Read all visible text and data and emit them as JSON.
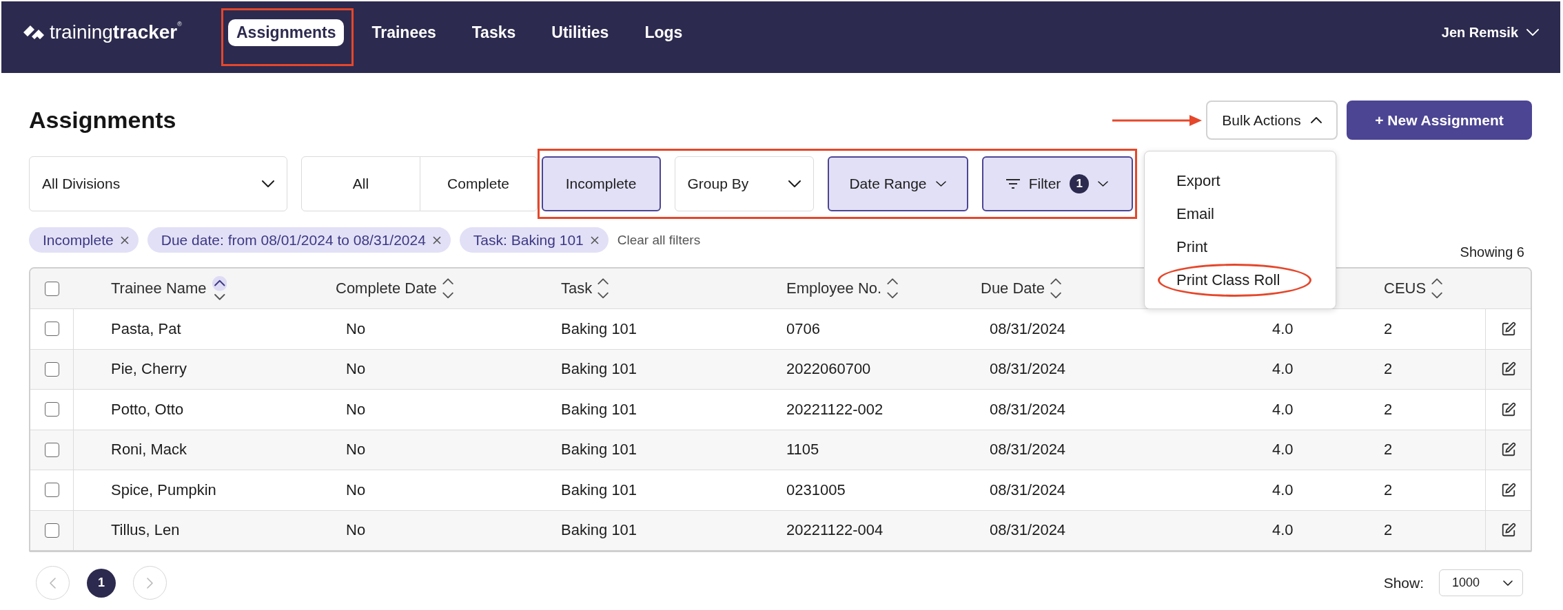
{
  "nav": {
    "logo": "training**tracker**$^{®}$",
    "items": [
      {
        "label": "Assignments",
        "selected": true,
        "highlighted": true
      },
      {
        "label": "Trainees",
        "selected": false,
        "highlighted": false
      },
      {
        "label": "Tasks",
        "selected": false,
        "highlighted": false
      },
      {
        "label": "Utilities",
        "selected": false,
        "highlighted": false
      },
      {
        "label": "Logs",
        "selected": false,
        "highlighted": false
      }
    ],
    "user": "Jen Remsik"
  },
  "page_title": "Assignments",
  "bulk_actions": {
    "label": "Bulk Actions",
    "expanded": true,
    "pointed_at": true,
    "menu": [
      {
        "label": "Export",
        "circled": false
      },
      {
        "label": "Email",
        "circled": false
      },
      {
        "label": "Print",
        "circled": false
      },
      {
        "label": "Print Class Roll",
        "circled": true
      }
    ]
  },
  "new_button": {
    "label": "+ New Assignment"
  },
  "toolbar": {
    "items": [
      {
        "kind": "select",
        "label": "All Divisions",
        "active": false,
        "highlighted": false
      },
      {
        "kind": "segment",
        "label": "All",
        "selected": false,
        "highlighted": false
      },
      {
        "kind": "segment",
        "label": "Complete",
        "selected": false,
        "highlighted": false
      },
      {
        "kind": "segment",
        "label": "Incomplete",
        "selected": true,
        "highlighted": true
      },
      {
        "kind": "select",
        "label": "Group By",
        "active": false,
        "highlighted": true
      },
      {
        "kind": "dropdown",
        "label": "Date Range",
        "active": true,
        "highlighted": true
      },
      {
        "kind": "filter",
        "label": "Filter",
        "count": "1",
        "active": true,
        "highlighted": true
      }
    ]
  },
  "chips": {
    "items": [
      {
        "label": "Incomplete"
      },
      {
        "label": "Due date: from 08/01/2024 to 08/31/2024"
      },
      {
        "label": "Task: Baking 101"
      }
    ],
    "clear_all": "Clear all filters"
  },
  "summary": "Showing 6",
  "table": {
    "select_all": {
      "checked": false
    },
    "columns": [
      {
        "label": "Trainee Name",
        "sort_ascending": true
      },
      {
        "label": "Complete Date",
        "sort_ascending": false
      },
      {
        "label": "Task",
        "sort_ascending": false
      },
      {
        "label": "Employee No.",
        "sort_ascending": false
      },
      {
        "label": "Due Date",
        "sort_ascending": false
      },
      {},
      {
        "label": "CEUS",
        "sort_ascending": false
      }
    ],
    "rows": [
      {
        "selected": false,
        "cells": [
          "Pasta, Pat",
          "No",
          "Baking 101",
          "0706",
          "08/31/2024",
          "4.0",
          "2"
        ]
      },
      {
        "selected": false,
        "cells": [
          "Pie, Cherry",
          "No",
          "Baking 101",
          "2022060700",
          "08/31/2024",
          "4.0",
          "2"
        ]
      },
      {
        "selected": false,
        "cells": [
          "Potto, Otto",
          "No",
          "Baking 101",
          "20221122-002",
          "08/31/2024",
          "4.0",
          "2"
        ]
      },
      {
        "selected": false,
        "cells": [
          "Roni, Mack",
          "No",
          "Baking 101",
          "1105",
          "08/31/2024",
          "4.0",
          "2"
        ]
      },
      {
        "selected": false,
        "cells": [
          "Spice, Pumpkin",
          "No",
          "Baking 101",
          "0231005",
          "08/31/2024",
          "4.0",
          "2"
        ]
      },
      {
        "selected": false,
        "cells": [
          "Tillus, Len",
          "No",
          "Baking 101",
          "20221122-004",
          "08/31/2024",
          "4.0",
          "2"
        ]
      }
    ]
  },
  "pager": {
    "previous": {
      "disabled": true
    },
    "pages": [
      {
        "label": "1",
        "selected": true
      }
    ],
    "next": {
      "disabled": true
    },
    "show_label": "Show:",
    "page_size": "1000"
  }
}
